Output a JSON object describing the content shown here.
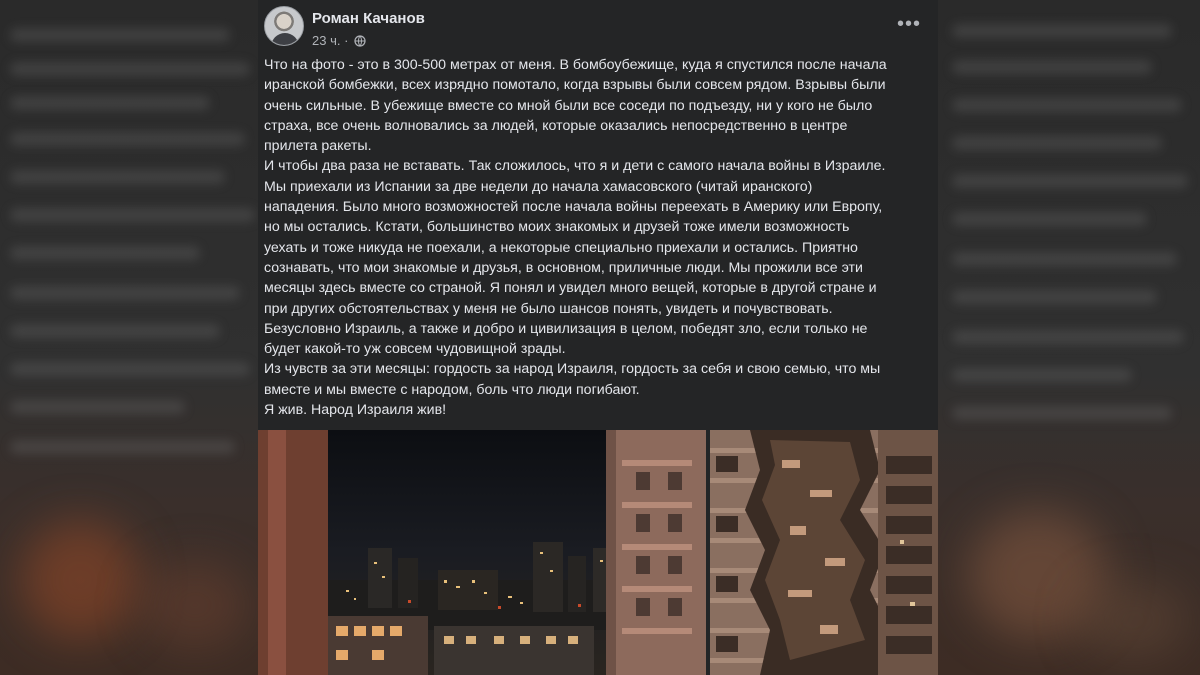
{
  "post": {
    "author": "Роман Качанов",
    "time": "23 ч. ·",
    "more_label": "•••",
    "icons": {
      "globe": "globe-icon",
      "more": "more-horizontal-icon",
      "avatar": "profile-photo"
    },
    "text_lines": [
      "Что на фото - это в 300-500 метрах от меня. В бомбоубежище, куда я спустился после начала",
      "иранской бомбежки, всех изрядно помотало, когда взрывы были совсем рядом. Взрывы были",
      "очень сильные. В убежище вместе со мной были все соседи по подъезду, ни у кого не было",
      "страха, все очень волновались за людей, которые оказались непосредственно в центре",
      "прилета ракеты.",
      "И чтобы два раза не вставать. Так сложилось, что я и дети  с самого начала войны в Израиле.",
      "Мы приехали из Испании за две недели до начала хамасовского (читай иранского)",
      "нападения. Было много возможностей после начала войны переехать в Америку или Европу,",
      "но мы остались. Кстати, большинство моих знакомых и друзей тоже имели возможность",
      "уехать и тоже никуда не поехали, а некоторые специально приехали и остались. Приятно",
      "сознавать, что мои знакомые и друзья, в основном, приличные люди. Мы прожили все эти",
      "месяцы здесь вместе со страной. Я понял и увидел много вещей, которые в другой стране и",
      "при других обстоятельствах у меня не было шансов понять, увидеть и почувствовать.",
      "Безусловно Израиль, а также и добро и цивилизация в целом, победят зло, если только не",
      "будет какой-то уж совсем чудовищной зрады.",
      "Из чувств за эти месяцы: гордость за народ Израиля, гордость за себя и свою семью, что мы",
      "вместе и мы вместе с народом, боль что люди погибают.",
      "Я жив. Народ Израиля жив!"
    ],
    "photos": [
      {
        "name": "night-city-photo",
        "alt_icon": "photo-icon"
      },
      {
        "name": "damaged-building-photo",
        "alt_icon": "photo-icon"
      }
    ]
  },
  "colors": {
    "card_bg": "#242526",
    "primary_text": "#e4e6eb",
    "secondary_text": "#b0b3b8"
  }
}
